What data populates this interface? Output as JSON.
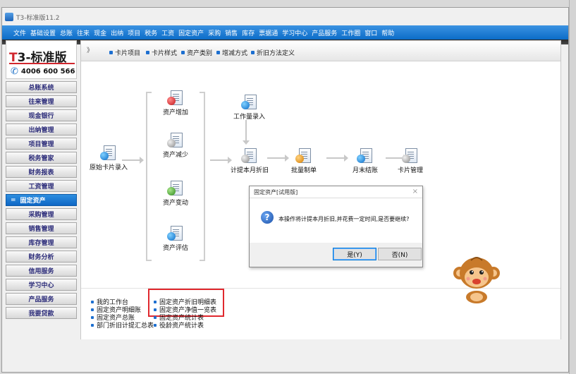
{
  "window": {
    "title": "T3-标准版11.2"
  },
  "menu": [
    "文件",
    "基础设置",
    "总账",
    "往来",
    "现金",
    "出纳",
    "项目",
    "税务",
    "工资",
    "固定资产",
    "采购",
    "销售",
    "库存",
    "票据通",
    "学习中心",
    "产品服务",
    "工作圈",
    "窗口",
    "帮助"
  ],
  "logo": {
    "brand_t": "T",
    "brand_rest": "3-标准版",
    "phone": "4006 600 566"
  },
  "sidebar": {
    "items": [
      {
        "label": "总账系统"
      },
      {
        "label": "往来管理"
      },
      {
        "label": "现金银行"
      },
      {
        "label": "出纳管理"
      },
      {
        "label": "项目管理"
      },
      {
        "label": "税务管家"
      },
      {
        "label": "财务报表"
      },
      {
        "label": "工资管理"
      },
      {
        "label": "固定资产",
        "active": true
      },
      {
        "label": "采购管理"
      },
      {
        "label": "销售管理"
      },
      {
        "label": "库存管理"
      },
      {
        "label": "财务分析"
      },
      {
        "label": "信用服务"
      },
      {
        "label": "学习中心"
      },
      {
        "label": "产品服务"
      },
      {
        "label": "我要贷款"
      }
    ],
    "active_marker": "="
  },
  "subbar": {
    "arrow": "》",
    "items": [
      "卡片项目",
      "卡片样式",
      "资产类别",
      "增减方式",
      "折旧方法定义"
    ]
  },
  "flow": {
    "original_card": "原始卡片录入",
    "asset_add": "资产增加",
    "asset_reduce": "资产减少",
    "asset_change": "资产变动",
    "asset_eval": "资产评估",
    "workload_entry": "工作量录入",
    "depreciation": "计提本月折旧",
    "batch_voucher": "批量制单",
    "month_close": "月末结账",
    "card_mgmt": "卡片管理"
  },
  "bottom_links": {
    "col1": [
      "我的工作台",
      "固定资产明细账",
      "固定资产总账",
      "部门折旧计提汇总表"
    ],
    "col2": [
      "固定资产折旧明细表",
      "固定资产净值一览表",
      "固定资产统计表",
      "役龄资产统计表"
    ]
  },
  "dialog": {
    "title": "固定资产[试用版]",
    "close": "×",
    "message": "本操作将计提本月折旧,并花费一定时间,是否要继续?",
    "yes_label": "是(Y)",
    "no_label": "否(N)"
  },
  "colors": {
    "menubar": "#0b6cc8",
    "accent": "#1d6fd0",
    "highlight": "#e0282e"
  }
}
